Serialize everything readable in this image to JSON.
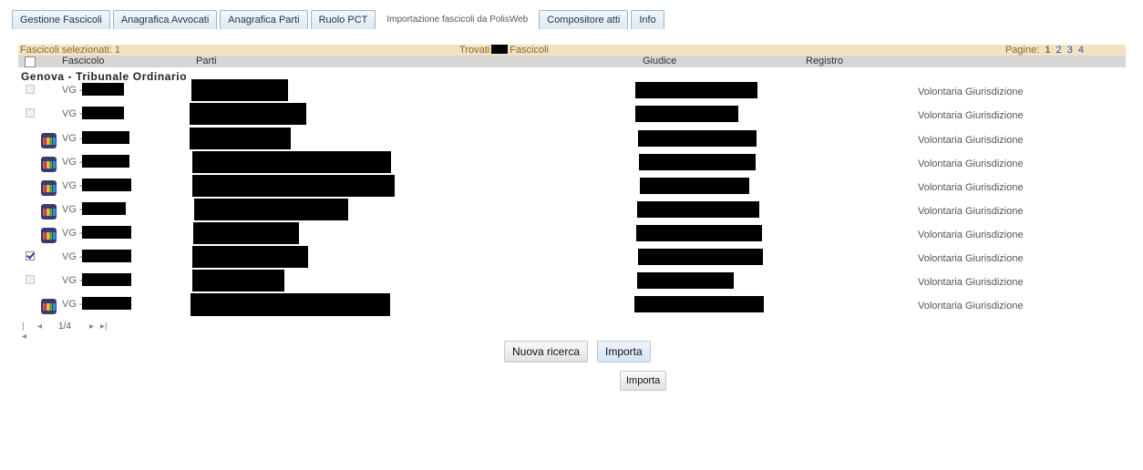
{
  "tabs": [
    {
      "label": "Gestione Fascicoli"
    },
    {
      "label": "Anagrafica Avvocati"
    },
    {
      "label": "Anagrafica Parti"
    },
    {
      "label": "Ruolo PCT"
    },
    {
      "label": "Importazione fascicoli da PolisWeb"
    },
    {
      "label": "Compositore atti"
    },
    {
      "label": "Info"
    }
  ],
  "header": {
    "selected": "Fascicoli selezionati: 1",
    "found_prefix": "Trovati",
    "found_suffix": "Fascicoli",
    "pages_label": "Pagine:",
    "current_page": "1",
    "other_pages": [
      "2",
      "3",
      "4"
    ]
  },
  "columns": {
    "fascicolo": "Fascicolo",
    "parti": "Parti",
    "giudice": "Giudice",
    "registro": "Registro"
  },
  "group_title": "Genova - Tribunale Ordinario",
  "rows": [
    {
      "prefix": "VG -",
      "registro": "Volontaria Giurisdizione",
      "selector": "checkbox",
      "checked": false
    },
    {
      "prefix": "VG -",
      "registro": "Volontaria Giurisdizione",
      "selector": "checkbox",
      "checked": false
    },
    {
      "prefix": "VG -",
      "registro": "Volontaria Giurisdizione",
      "selector": "pct-icon",
      "checked": false
    },
    {
      "prefix": "VG -",
      "registro": "Volontaria Giurisdizione",
      "selector": "pct-icon",
      "checked": false
    },
    {
      "prefix": "VG -",
      "registro": "Volontaria Giurisdizione",
      "selector": "pct-icon",
      "checked": false
    },
    {
      "prefix": "VG -",
      "registro": "Volontaria Giurisdizione",
      "selector": "pct-icon",
      "checked": false
    },
    {
      "prefix": "VG -",
      "registro": "Volontaria Giurisdizione",
      "selector": "pct-icon",
      "checked": false
    },
    {
      "prefix": "VG -",
      "registro": "Volontaria Giurisdizione",
      "selector": "checkbox",
      "checked": true
    },
    {
      "prefix": "VG -",
      "registro": "Volontaria Giurisdizione",
      "selector": "checkbox",
      "checked": false
    },
    {
      "prefix": "VG -",
      "registro": "Volontaria Giurisdizione",
      "selector": "pct-icon",
      "checked": false
    }
  ],
  "pager": {
    "first": "|◂",
    "prev": "◂",
    "position": "1/4",
    "next": "▸",
    "last": "▸|"
  },
  "buttons": {
    "new_search": "Nuova ricerca",
    "import": "Importa",
    "import_bottom": "Importa"
  },
  "colors": {
    "header_bg": "#f2e2c0",
    "columns_bg": "#d6d6d6",
    "link": "#2a4fbf",
    "redaction": "#000000"
  }
}
